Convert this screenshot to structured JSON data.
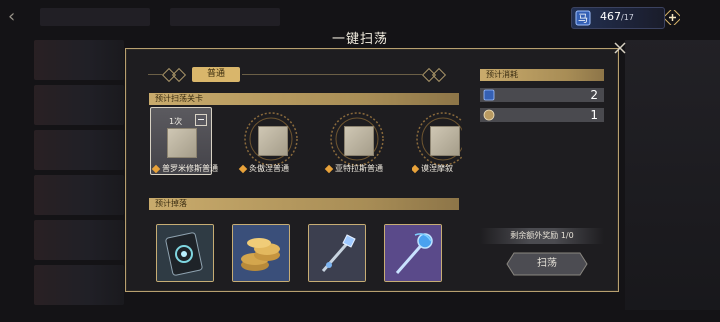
{
  "modal": {
    "title": "一键扫荡"
  },
  "currency": {
    "value": "467",
    "max": "/17"
  },
  "left": {
    "tab_label": "普通",
    "stages_header": "预计扫荡关卡",
    "stages": [
      {
        "label": "普罗米修斯普通",
        "count": "1次",
        "selected": true
      },
      {
        "label": "灸傲涅普通",
        "selected": false
      },
      {
        "label": "亚特拉斯普通",
        "selected": false
      },
      {
        "label": "谟涅摩叙",
        "selected": false
      }
    ],
    "drops_header": "预计掉落",
    "drops": [
      {
        "icon": "dark-card-item-icon"
      },
      {
        "icon": "gold-coins-icon"
      },
      {
        "icon": "crystal-staff-icon"
      },
      {
        "icon": "blue-staff-icon"
      }
    ]
  },
  "right": {
    "cost_header": "预计消耗",
    "costs": [
      {
        "icon": "stamina-ticket-icon",
        "value": "2"
      },
      {
        "icon": "sweep-token-icon",
        "value": "1"
      }
    ],
    "extra_reward": "剩余额外奖励  1/0",
    "sweep_button": "扫荡"
  },
  "colors": {
    "gold": "#d9b66b",
    "panel": "#1e1d20",
    "accent_blue": "#2a4a8c"
  }
}
